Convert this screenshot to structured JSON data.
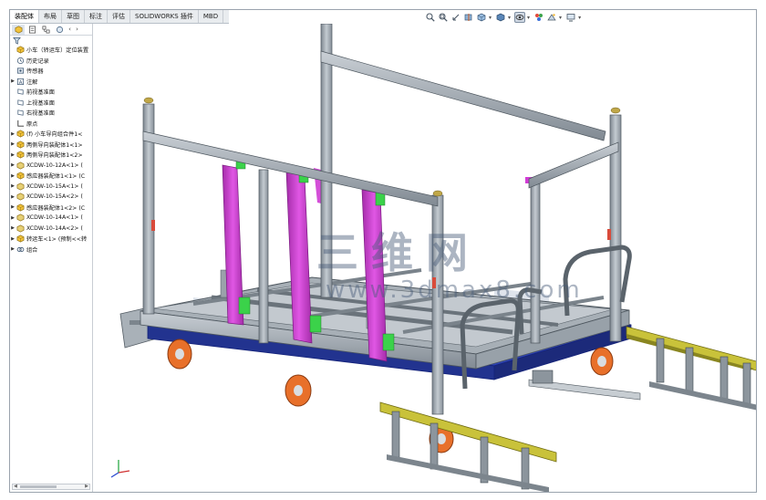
{
  "tabs": [
    {
      "label": "装配体",
      "active": true
    },
    {
      "label": "布局",
      "active": false
    },
    {
      "label": "草图",
      "active": false
    },
    {
      "label": "标注",
      "active": false
    },
    {
      "label": "评估",
      "active": false
    },
    {
      "label": "SOLIDWORKS 插件",
      "active": false
    },
    {
      "label": "MBD",
      "active": false
    }
  ],
  "view_toolbar": [
    {
      "icon": "zoom-to-fit-icon"
    },
    {
      "icon": "zoom-to-area-icon"
    },
    {
      "icon": "previous-view-icon"
    },
    {
      "icon": "section-view-icon"
    },
    {
      "icon": "view-orientation-icon"
    },
    {
      "icon": "display-style-icon"
    },
    {
      "icon": "hide-show-items-icon"
    },
    {
      "icon": "edit-appearance-icon"
    },
    {
      "icon": "apply-scene-icon"
    },
    {
      "icon": "view-settings-icon"
    }
  ],
  "feature_tree": {
    "root": "小车（转运车）定位装置",
    "items": [
      {
        "label": "历史记录",
        "icon": "history-icon",
        "expandable": false
      },
      {
        "label": "传感器",
        "icon": "sensor-icon",
        "expandable": false
      },
      {
        "label": "注解",
        "icon": "annotation-icon",
        "expandable": true
      },
      {
        "label": "前视基准面",
        "icon": "plane-icon",
        "expandable": false
      },
      {
        "label": "上视基准面",
        "icon": "plane-icon",
        "expandable": false
      },
      {
        "label": "右视基准面",
        "icon": "plane-icon",
        "expandable": false
      },
      {
        "label": "原点",
        "icon": "origin-icon",
        "expandable": false
      },
      {
        "label": "(f) 小车导向组合件1<",
        "icon": "assembly-icon",
        "expandable": true
      },
      {
        "label": "两侧导向装配体1<1>",
        "icon": "assembly-icon",
        "expandable": true
      },
      {
        "label": "两侧导向装配体1<2>",
        "icon": "assembly-icon",
        "expandable": true
      },
      {
        "label": "XCDW-10-12A<1> (",
        "icon": "part-icon",
        "expandable": true
      },
      {
        "label": "感应器装配体1<1> (C",
        "icon": "assembly-icon",
        "expandable": true
      },
      {
        "label": "XCDW-10-15A<1> (",
        "icon": "part-icon",
        "expandable": true
      },
      {
        "label": "XCDW-10-15A<2> (",
        "icon": "part-icon",
        "expandable": true
      },
      {
        "label": "感应器装配体1<2> (C",
        "icon": "assembly-icon",
        "expandable": true
      },
      {
        "label": "XCDW-10-14A<1> (",
        "icon": "part-icon",
        "expandable": true
      },
      {
        "label": "XCDW-10-14A<2> (",
        "icon": "part-icon",
        "expandable": true
      },
      {
        "label": "转运车<1> (预制<<转",
        "icon": "assembly-icon",
        "expandable": true
      },
      {
        "label": "组合",
        "icon": "mates-icon",
        "expandable": true
      }
    ]
  },
  "watermark": {
    "cn": "三维网",
    "url": "www.3dmax8.com"
  },
  "colors": {
    "frame": "#9ea6ad",
    "magenta": "#d23cd6",
    "blue_base": "#2b3fa8",
    "wheel": "#e8702a",
    "yellow": "#c9c23a"
  }
}
